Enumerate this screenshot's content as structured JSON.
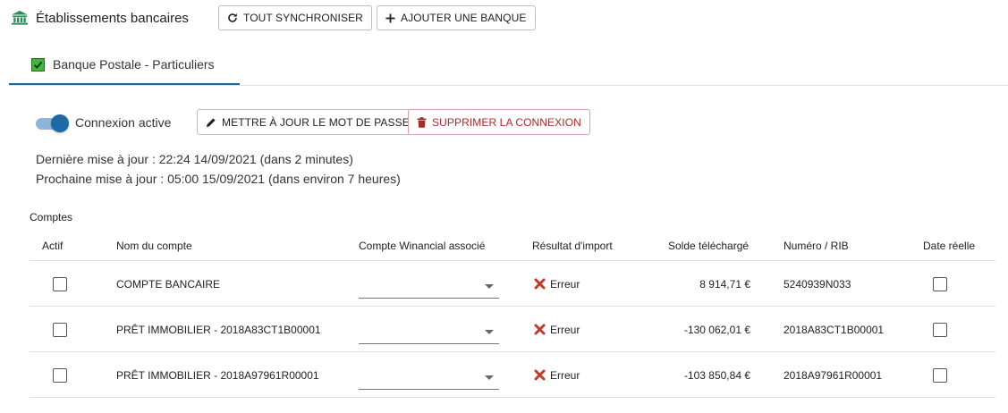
{
  "header": {
    "title": "Établissements bancaires",
    "sync_all_label": "TOUT SYNCHRONISER",
    "add_bank_label": "AJOUTER UNE BANQUE"
  },
  "tab": {
    "label": "Banque Postale - Particuliers",
    "checked": true
  },
  "connection": {
    "active_label": "Connexion active",
    "active": true,
    "update_password_label": "METTRE À JOUR LE MOT DE PASSE",
    "delete_connection_label": "SUPPRIMER LA CONNEXION",
    "last_update": "Dernière mise à jour : 22:24 14/09/2021 (dans 2 minutes)",
    "next_update": "Prochaine mise à jour : 05:00 15/09/2021 (dans environ 7 heures)"
  },
  "accounts": {
    "section_title": "Comptes",
    "columns": {
      "active": "Actif",
      "name": "Nom du compte",
      "winancial": "Compte Winancial associé",
      "import_result": "Résultat d'import",
      "balance": "Solde téléchargé",
      "rib": "Numéro / RIB",
      "real_date": "Date réelle"
    },
    "rows": [
      {
        "name": "COMPTE BANCAIRE",
        "winancial": "",
        "result": "Erreur",
        "balance": "8 914,71 €",
        "rib": "5240939N033"
      },
      {
        "name": "PRÊT IMMOBILIER - 2018A83CT1B00001",
        "winancial": "",
        "result": "Erreur",
        "balance": "-130 062,01 €",
        "rib": "2018A83CT1B00001"
      },
      {
        "name": "PRÊT IMMOBILIER - 2018A97961R00001",
        "winancial": "",
        "result": "Erreur",
        "balance": "-103 850,84 €",
        "rib": "2018A97961R00001"
      }
    ]
  },
  "colors": {
    "accent": "#1e6aa5",
    "danger": "#b02828",
    "tab_check": "#3fb93b",
    "bank_icon": "#2e8b57"
  }
}
